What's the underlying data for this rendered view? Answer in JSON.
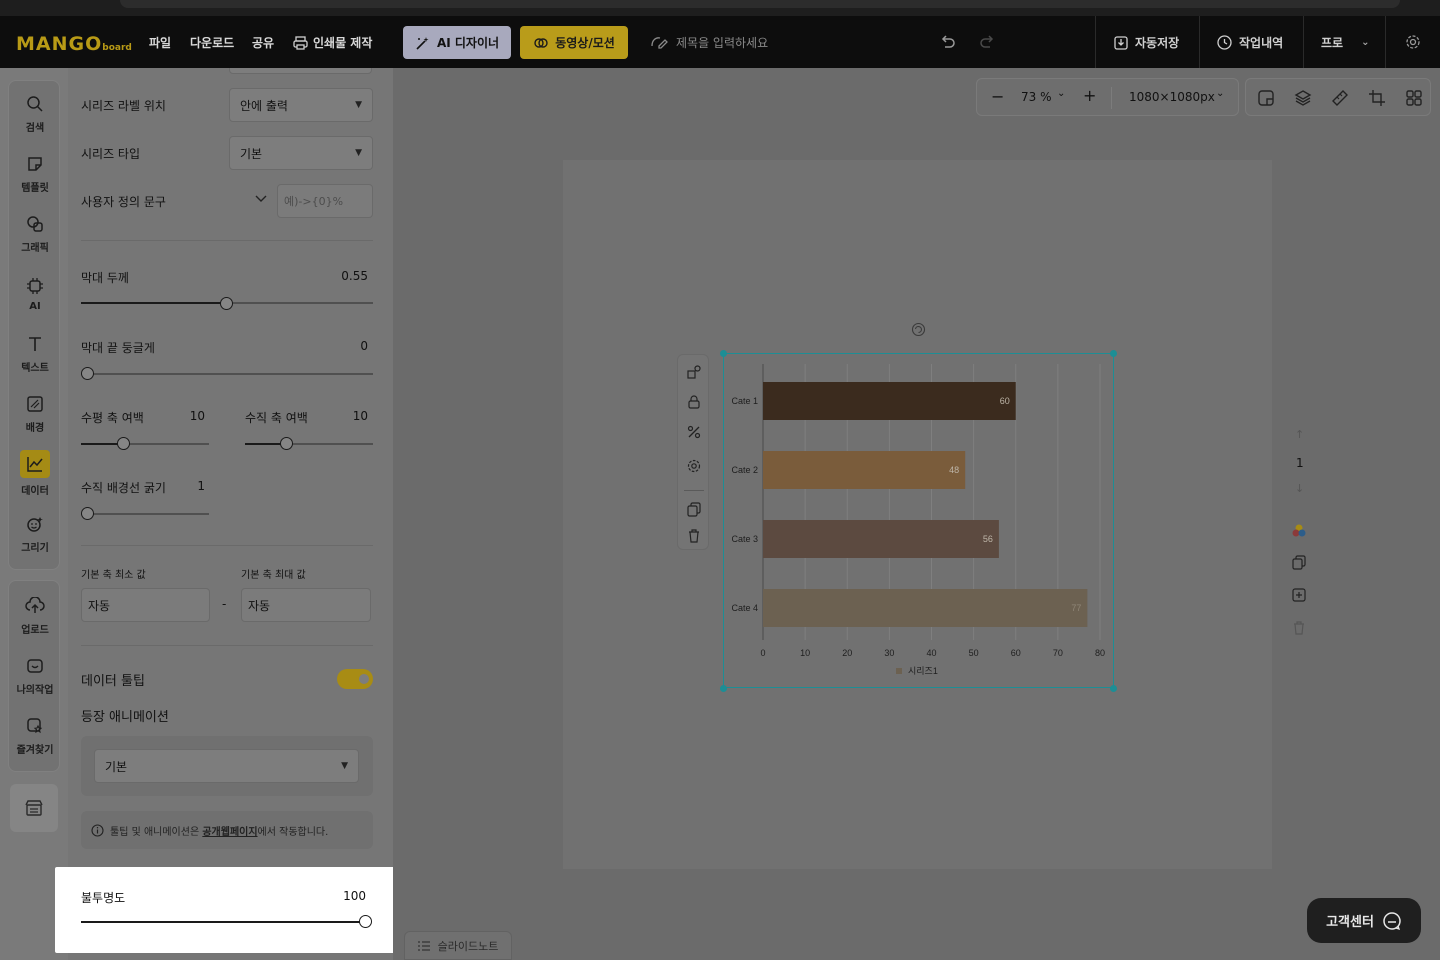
{
  "topbar": {
    "logo_main": "MANGO",
    "logo_sub": "board",
    "menu": [
      "파일",
      "다운로드",
      "공유"
    ],
    "print_label": "인쇄물 제작",
    "ai_button": "AI 디자이너",
    "video_button": "동영상/모션",
    "title_placeholder": "제목을 입력하세요",
    "autosave": "자동저장",
    "history": "작업내역",
    "plan": "프로"
  },
  "rail": {
    "top": [
      "검색",
      "템플릿",
      "그래픽",
      "AI",
      "텍스트",
      "배경",
      "데이터",
      "그리기"
    ],
    "bottom": [
      "업로드",
      "나의작업",
      "즐겨찾기"
    ]
  },
  "panel": {
    "series_label_pos": {
      "label": "시리즈 라벨 위치",
      "value": "안에 출력"
    },
    "series_type": {
      "label": "시리즈 타입",
      "value": "기본"
    },
    "custom_text": {
      "label": "사용자 정의 문구",
      "placeholder": "예)->{0}%"
    },
    "bar_thickness": {
      "label": "막대 두께",
      "value": "0.55",
      "ratio": 0.55
    },
    "bar_round": {
      "label": "막대 끝 둥글게",
      "value": "0",
      "ratio": 0
    },
    "h_margin": {
      "label": "수평 축 여백",
      "value": "10",
      "ratio": 0.33
    },
    "v_margin": {
      "label": "수직 축 여백",
      "value": "10",
      "ratio": 0.33
    },
    "v_grid": {
      "label": "수직 배경선 굵기",
      "value": "1",
      "ratio": 0
    },
    "axis_min": {
      "label": "기본 축 최소 값",
      "value": "자동"
    },
    "axis_max": {
      "label": "기본 축 최대 값",
      "value": "자동"
    },
    "range_sep": "-",
    "tooltip": {
      "label": "데이터 툴팁",
      "on": true
    },
    "animation": {
      "label": "등장 애니메이션",
      "value": "기본"
    },
    "info": {
      "prefix": "툴팁 및 애니메이션은 ",
      "link": "공개웹페이지",
      "suffix": "에서 작동합니다."
    }
  },
  "opacity": {
    "label": "불투명도",
    "value": "100",
    "ratio": 1
  },
  "zoom": {
    "value": "73 %",
    "size": "1080×1080px"
  },
  "page": {
    "number": "1"
  },
  "support_button": "고객센터",
  "slide_note": "슬라이드노트",
  "colors": {
    "accent": "#b99c1a",
    "selection": "#1d8e95"
  },
  "chart_data": {
    "type": "bar",
    "orientation": "horizontal",
    "categories": [
      "Cate 1",
      "Cate 2",
      "Cate 3",
      "Cate 4"
    ],
    "series": [
      {
        "name": "시리즈1",
        "values": [
          60,
          48,
          56,
          77
        ]
      }
    ],
    "bar_colors": [
      "#3b2b1e",
      "#7a5c3b",
      "#5c4a40",
      "#6c6151"
    ],
    "xlim": [
      0,
      80
    ],
    "xticks": [
      "0",
      "10",
      "20",
      "30",
      "40",
      "50",
      "60",
      "70",
      "80"
    ],
    "legend": "bottom",
    "grid": true
  }
}
